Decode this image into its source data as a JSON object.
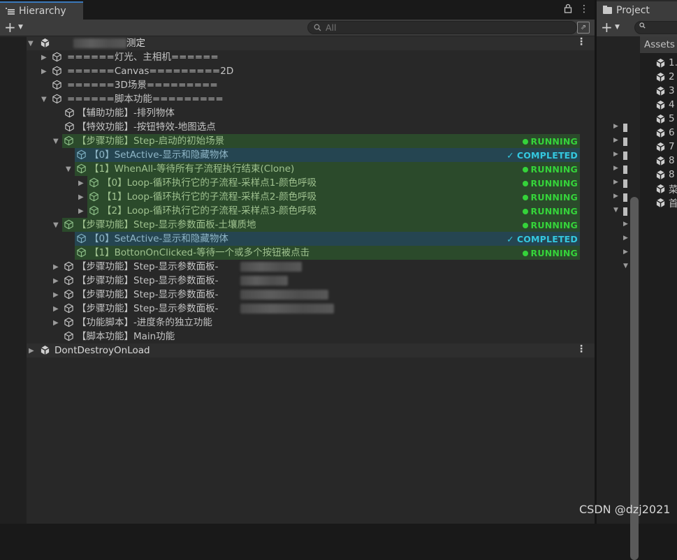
{
  "hierarchy": {
    "tab_label": "Hierarchy",
    "search_placeholder": "All",
    "plus_label": "+",
    "scene_name": "测定",
    "rows": [
      {
        "label": "======灯光、主相机======"
      },
      {
        "label": "======Canvas=========2D"
      },
      {
        "label": "======3D场景========="
      },
      {
        "label": "======脚本功能========="
      },
      {
        "label": "【辅助功能】-排列物体"
      },
      {
        "label": "【特效功能】-按钮特效-地图选点"
      },
      {
        "label": "【步骤功能】Step-启动的初始场景",
        "status": "RUNNING"
      },
      {
        "label": "【0】SetActive-显示和隐藏物体",
        "status": "COMPLETED"
      },
      {
        "label": "【1】WhenAll-等待所有子流程执行结束(Clone)",
        "status": "RUNNING"
      },
      {
        "label": "【0】Loop-循环执行它的子流程-采样点1-颜色呼吸",
        "status": "RUNNING"
      },
      {
        "label": "【1】Loop-循环执行它的子流程-采样点2-颜色呼吸",
        "status": "RUNNING"
      },
      {
        "label": "【2】Loop-循环执行它的子流程-采样点3-颜色呼吸",
        "status": "RUNNING"
      },
      {
        "label": "【步骤功能】Step-显示参数面板-土壤质地",
        "status": "RUNNING"
      },
      {
        "label": "【0】SetActive-显示和隐藏物体",
        "status": "COMPLETED"
      },
      {
        "label": "【1】BottonOnClicked-等待一个或多个按钮被点击",
        "status": "RUNNING"
      },
      {
        "label": "【步骤功能】Step-显示参数面板-"
      },
      {
        "label": "【步骤功能】Step-显示参数面板-"
      },
      {
        "label": "【步骤功能】Step-显示参数面板-"
      },
      {
        "label": "【步骤功能】Step-显示参数面板-"
      },
      {
        "label": "【功能脚本】-进度条的独立功能"
      },
      {
        "label": "【脚本功能】Main功能"
      }
    ],
    "dont_destroy": "DontDestroyOnLoad"
  },
  "status_text": {
    "running": "RUNNING",
    "completed": "COMPLETED"
  },
  "project": {
    "tab_label": "Project",
    "assets_header": "Assets",
    "items": [
      "1.",
      "2",
      "3",
      "4",
      "5",
      "6",
      "7",
      "8",
      "8",
      "菜",
      "首"
    ]
  },
  "watermark": "CSDN @dzj2021",
  "colors": {
    "running": "#35d33a",
    "completed": "#34c8e0",
    "running_row": "#2b4a2b",
    "completed_row": "#254551",
    "tab_accent": "#3a79bb"
  }
}
